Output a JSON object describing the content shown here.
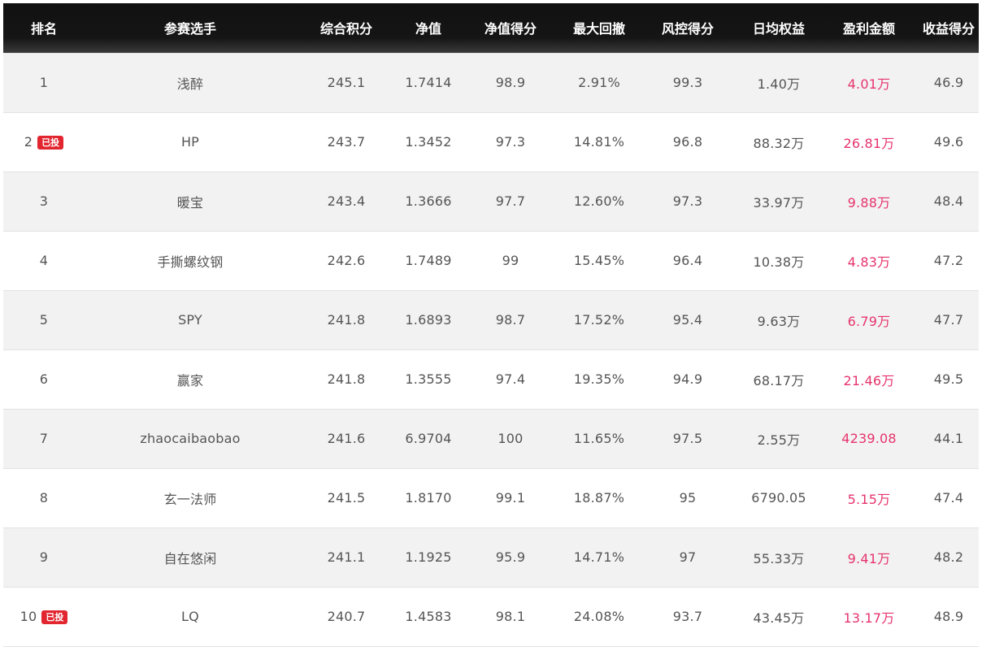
{
  "table": {
    "headers": [
      "排名",
      "参赛选手",
      "综合积分",
      "净值",
      "净值得分",
      "最大回撤",
      "风控得分",
      "日均权益",
      "盈利金额",
      "收益得分"
    ],
    "rows": [
      {
        "rank": "1",
        "badge": "",
        "player": "浅醉",
        "score": "245.1",
        "nav": "1.7414",
        "nav_score": "98.9",
        "max_drawdown": "2.91%",
        "risk_score": "99.3",
        "avg_equity": "1.40万",
        "profit": "4.01万",
        "return_score": "46.9"
      },
      {
        "rank": "2",
        "badge": "已投",
        "player": "HP",
        "score": "243.7",
        "nav": "1.3452",
        "nav_score": "97.3",
        "max_drawdown": "14.81%",
        "risk_score": "96.8",
        "avg_equity": "88.32万",
        "profit": "26.81万",
        "return_score": "49.6"
      },
      {
        "rank": "3",
        "badge": "",
        "player": "暖宝",
        "score": "243.4",
        "nav": "1.3666",
        "nav_score": "97.7",
        "max_drawdown": "12.60%",
        "risk_score": "97.3",
        "avg_equity": "33.97万",
        "profit": "9.88万",
        "return_score": "48.4"
      },
      {
        "rank": "4",
        "badge": "",
        "player": "手撕螺纹钢",
        "score": "242.6",
        "nav": "1.7489",
        "nav_score": "99",
        "max_drawdown": "15.45%",
        "risk_score": "96.4",
        "avg_equity": "10.38万",
        "profit": "4.83万",
        "return_score": "47.2"
      },
      {
        "rank": "5",
        "badge": "",
        "player": "SPY",
        "score": "241.8",
        "nav": "1.6893",
        "nav_score": "98.7",
        "max_drawdown": "17.52%",
        "risk_score": "95.4",
        "avg_equity": "9.63万",
        "profit": "6.79万",
        "return_score": "47.7"
      },
      {
        "rank": "6",
        "badge": "",
        "player": "赢家",
        "score": "241.8",
        "nav": "1.3555",
        "nav_score": "97.4",
        "max_drawdown": "19.35%",
        "risk_score": "94.9",
        "avg_equity": "68.17万",
        "profit": "21.46万",
        "return_score": "49.5"
      },
      {
        "rank": "7",
        "badge": "",
        "player": "zhaocaibaobao",
        "score": "241.6",
        "nav": "6.9704",
        "nav_score": "100",
        "max_drawdown": "11.65%",
        "risk_score": "97.5",
        "avg_equity": "2.55万",
        "profit": "4239.08",
        "return_score": "44.1"
      },
      {
        "rank": "8",
        "badge": "",
        "player": "玄一法师",
        "score": "241.5",
        "nav": "1.8170",
        "nav_score": "99.1",
        "max_drawdown": "18.87%",
        "risk_score": "95",
        "avg_equity": "6790.05",
        "profit": "5.15万",
        "return_score": "47.4"
      },
      {
        "rank": "9",
        "badge": "",
        "player": "自在悠闲",
        "score": "241.1",
        "nav": "1.1925",
        "nav_score": "95.9",
        "max_drawdown": "14.71%",
        "risk_score": "97",
        "avg_equity": "55.33万",
        "profit": "9.41万",
        "return_score": "48.2"
      },
      {
        "rank": "10",
        "badge": "已投",
        "player": "LQ",
        "score": "240.7",
        "nav": "1.4583",
        "nav_score": "98.1",
        "max_drawdown": "24.08%",
        "risk_score": "93.7",
        "avg_equity": "43.45万",
        "profit": "13.17万",
        "return_score": "48.9"
      }
    ]
  },
  "colors": {
    "header_background": "#111111",
    "header_text": "#ffffff",
    "row_odd": "#f2f2f2",
    "row_even": "#ffffff",
    "text": "#555555",
    "profit": "#e6336d",
    "badge": "#e2262f"
  }
}
